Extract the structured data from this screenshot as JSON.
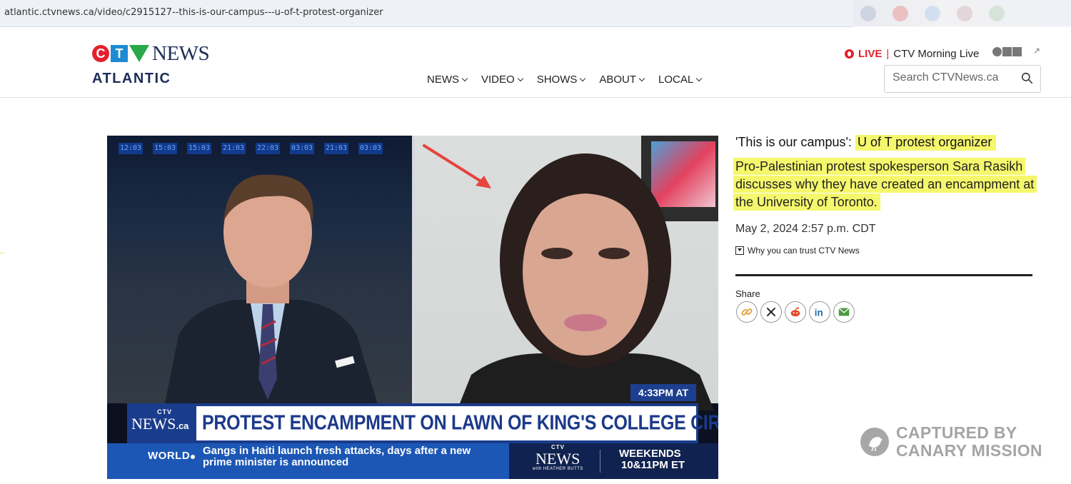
{
  "browser": {
    "url": "atlantic.ctvnews.ca/video/c2915127--this-is-our-campus---u-of-t-protest-organizer"
  },
  "header": {
    "logo_news": "NEWS",
    "region": "ATLANTIC",
    "nav": [
      "NEWS",
      "VIDEO",
      "SHOWS",
      "ABOUT",
      "LOCAL"
    ],
    "live_label": "LIVE",
    "live_separator": "|",
    "live_show": "CTV Morning Live",
    "search_placeholder": "Search CTVNews.ca"
  },
  "video": {
    "time_badge": "4:33PM AT",
    "lower_third_brand": "NEWS",
    "lower_third_brand_suffix": ".ca",
    "headline": "PROTEST ENCAMPMENT ON LAWN OF KING'S COLLEGE CIRCLE",
    "ticker_section": "WORLD",
    "ticker_text": "Gangs in Haiti launch fresh attacks, days after a new prime minister is announced",
    "promo_brand": "NEWS",
    "promo_host": "with HEATHER BUTTS",
    "promo_days": "WEEKENDS",
    "promo_time": "10&11PM ET",
    "board_times": [
      "12:03",
      "15:03",
      "15:03",
      "21:03",
      "22:03",
      "03:03",
      "21:03",
      "03:03"
    ]
  },
  "article": {
    "title_prefix": "'This is our campus':",
    "title_highlight": "U of T protest organizer",
    "description": "Pro-Palestinian protest spokesperson Sara Rasikh discusses why they have created an encampment at the University of Toronto.",
    "date": "May 2, 2024 2:57 p.m. CDT",
    "trust_link": "Why you can trust CTV News",
    "share_label": "Share",
    "share_icons": [
      "link-icon",
      "x-icon",
      "reddit-icon",
      "linkedin-icon",
      "email-icon"
    ]
  },
  "watermark": {
    "line1": "CAPTURED BY",
    "line2": "CANARY MISSION"
  },
  "colors": {
    "brand_navy": "#1c2d57",
    "live_red": "#e3202c",
    "highlight": "#f5f76c",
    "ticker_blue": "#1c57b5"
  }
}
